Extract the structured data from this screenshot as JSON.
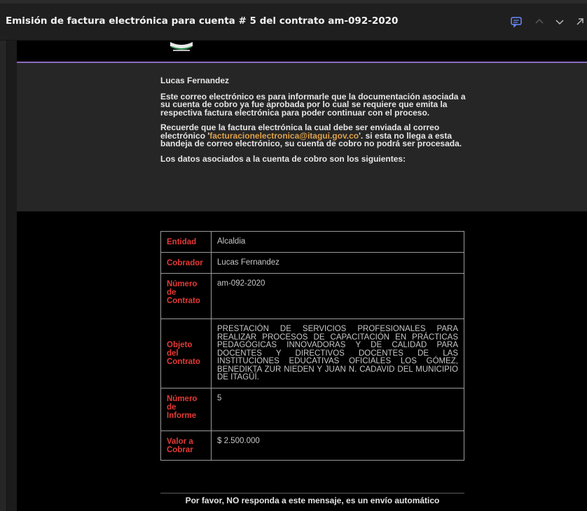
{
  "email": {
    "subject": "Emisión de factura electrónica para cuenta # 5 del contrato am-092-2020",
    "greeting": "Lucas Fernandez",
    "paragraph1": "Este correo electrónico es para informarle que la documentación asociada a su cuenta de cobro ya fue aprobada por lo cual se requiere que emita la respectiva factura electrónica para poder continuar con el proceso.",
    "paragraph2_before": "Recuerde que la factura electrónica la cual debe ser enviada al correo electrónico '",
    "paragraph2_email": "facturacionelectronica@itagui.gov.co",
    "paragraph2_after": "'. si esta no llega a esta bandeja de correo electrónico, su cuenta de cobro no podrá ser procesada.",
    "paragraph3": "Los datos asociados a la cuenta de cobro son los siguientes:",
    "footer": "Por favor, NO responda a este mensaje, es un envío automático"
  },
  "table": [
    {
      "label": "Entidad",
      "value": "Alcaldia"
    },
    {
      "label": "Cobrador",
      "value": "Lucas Fernandez"
    },
    {
      "label": "Número de Contrato",
      "value": "am-092-2020"
    },
    {
      "label": "Objeto del Contrato",
      "value": "PRESTACIÓN DE SERVICIOS PROFESIONALES PARA REALIZAR PROCESOS DE CAPACITACIÓN EN PRÁCTICAS PEDAGÓGICAS INNOVADORAS Y DE CALIDAD PARA DOCENTES Y DIRECTIVOS DOCENTES DE LAS INSTITUCIONES EDUCATIVAS OFICIALES LOS GÓMEZ, BENEDIKTA ZUR NIEDEN Y JUAN N. CADAVID DEL MUNICIPIO DE ITAGÜÍ."
    },
    {
      "label": "Número de Informe",
      "value": "5"
    },
    {
      "label": "Valor a Cobrar",
      "value": "$ 2.500.000"
    }
  ],
  "toolbar": {
    "icons": [
      "summary-icon",
      "previous-message-icon",
      "next-message-icon",
      "popout-icon"
    ]
  },
  "colors": {
    "accent": "#8b6bbd",
    "label_red": "#e53935",
    "email_link": "#e0a24a"
  }
}
